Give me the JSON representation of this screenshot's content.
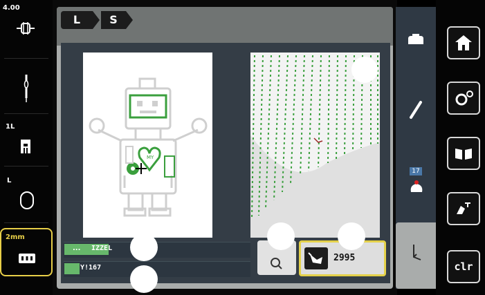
{
  "left_status": {
    "stitch_length_value": "4.00",
    "presser_foot_value": "1L",
    "thread_label": "L",
    "embroidery_tension_value": "2mm"
  },
  "breadcrumb": {
    "items": [
      "L",
      "S"
    ]
  },
  "info_bars": [
    {
      "fill_label": "...",
      "text": "IZZEL",
      "fill_fraction": 0.24
    },
    {
      "fill_label": "",
      "text": "Y!167",
      "fill_fraction": 0.08
    }
  ],
  "stitch_count": {
    "value": "2995"
  },
  "tools": {
    "badge_number": "17"
  },
  "nav": {
    "clear_label": "clr"
  },
  "colors": {
    "accent_yellow": "#e4d14a",
    "robot_green": "#3a9f3d",
    "panel_blue": "#343d46"
  }
}
